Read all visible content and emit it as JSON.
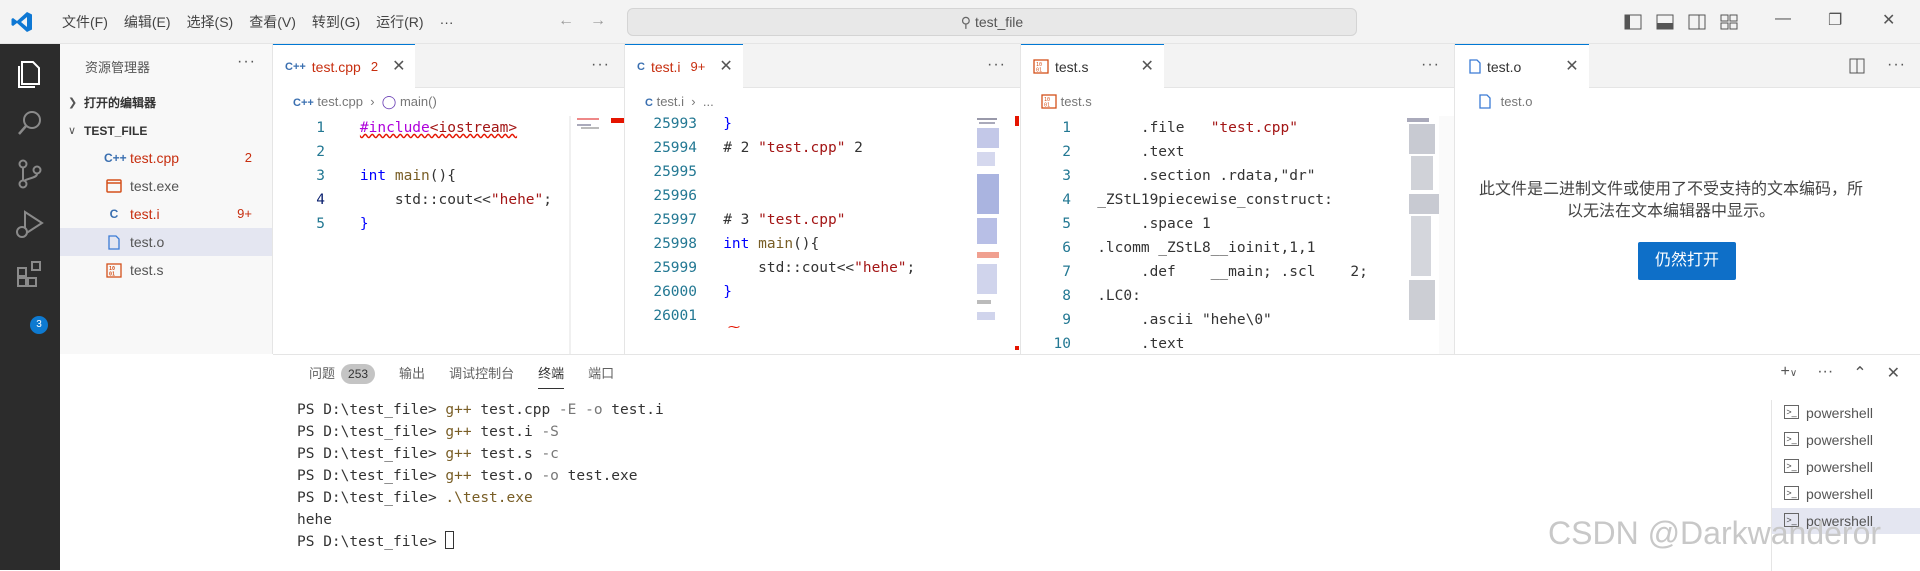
{
  "menu": [
    "文件(F)",
    "编辑(E)",
    "选择(S)",
    "查看(V)",
    "转到(G)",
    "运行(R)",
    "···"
  ],
  "search": {
    "text": "test_file"
  },
  "activity": {
    "extensions_badge": "3"
  },
  "sidebar": {
    "title": "资源管理器",
    "open_editors": "打开的编辑器",
    "folder": "TEST_FILE",
    "files": [
      {
        "name": "test.cpp",
        "icon": "C++",
        "badge": "2",
        "color": "#c72e0f"
      },
      {
        "name": "test.exe",
        "icon": "exe",
        "badge": "",
        "color": "#555555"
      },
      {
        "name": "test.i",
        "icon": "C",
        "badge": "9+",
        "color": "#c72e0f"
      },
      {
        "name": "test.o",
        "icon": "file",
        "badge": "",
        "color": "#555555"
      },
      {
        "name": "test.s",
        "icon": "asm",
        "badge": "",
        "color": "#555555"
      }
    ]
  },
  "editors": {
    "cpp": {
      "tab": "test.cpp",
      "tab_count": "2",
      "crumb_file": "test.cpp",
      "crumb_sym": "main()",
      "lines": [
        "1",
        "2",
        "3",
        "4",
        "5"
      ]
    },
    "i": {
      "tab": "test.i",
      "tab_count": "9+",
      "crumb_file": "test.i",
      "crumb_more": "...",
      "lines": [
        "25993",
        "25994",
        "25995",
        "25996",
        "25997",
        "25998",
        "25999",
        "26000",
        "26001"
      ]
    },
    "s": {
      "tab": "test.s",
      "crumb_file": "test.s",
      "lines": [
        "1",
        "2",
        "3",
        "4",
        "5",
        "6",
        "7",
        "8",
        "9",
        "10"
      ]
    },
    "o": {
      "tab": "test.o",
      "crumb_file": "test.o",
      "message": "此文件是二进制文件或使用了不受支持的文本编码，所以无法在文本编辑器中显示。",
      "button": "仍然打开"
    }
  },
  "panel": {
    "tabs": [
      "问题",
      "输出",
      "调试控制台",
      "终端",
      "端口"
    ],
    "problems_count": "253",
    "terminal_lines": [
      {
        "prompt": "PS D:\\test_file> ",
        "cmd": "g++",
        "args": " test.cpp ",
        "flag": "-E -o",
        "rest": " test.i"
      },
      {
        "prompt": "PS D:\\test_file> ",
        "cmd": "g++",
        "args": " test.i ",
        "flag": "-S",
        "rest": ""
      },
      {
        "prompt": "PS D:\\test_file> ",
        "cmd": "g++",
        "args": " test.s ",
        "flag": "-c",
        "rest": ""
      },
      {
        "prompt": "PS D:\\test_file> ",
        "cmd": "g++",
        "args": " test.o ",
        "flag": "-o",
        "rest": " test.exe"
      },
      {
        "prompt": "PS D:\\test_file> ",
        "cmd": ".\\test.exe",
        "args": "",
        "flag": "",
        "rest": ""
      }
    ],
    "output": "hehe",
    "last_prompt": "PS D:\\test_file> ",
    "terminals": [
      "powershell",
      "powershell",
      "powershell",
      "powershell",
      "powershell"
    ]
  },
  "watermark": "CSDN @Darkwanderor"
}
